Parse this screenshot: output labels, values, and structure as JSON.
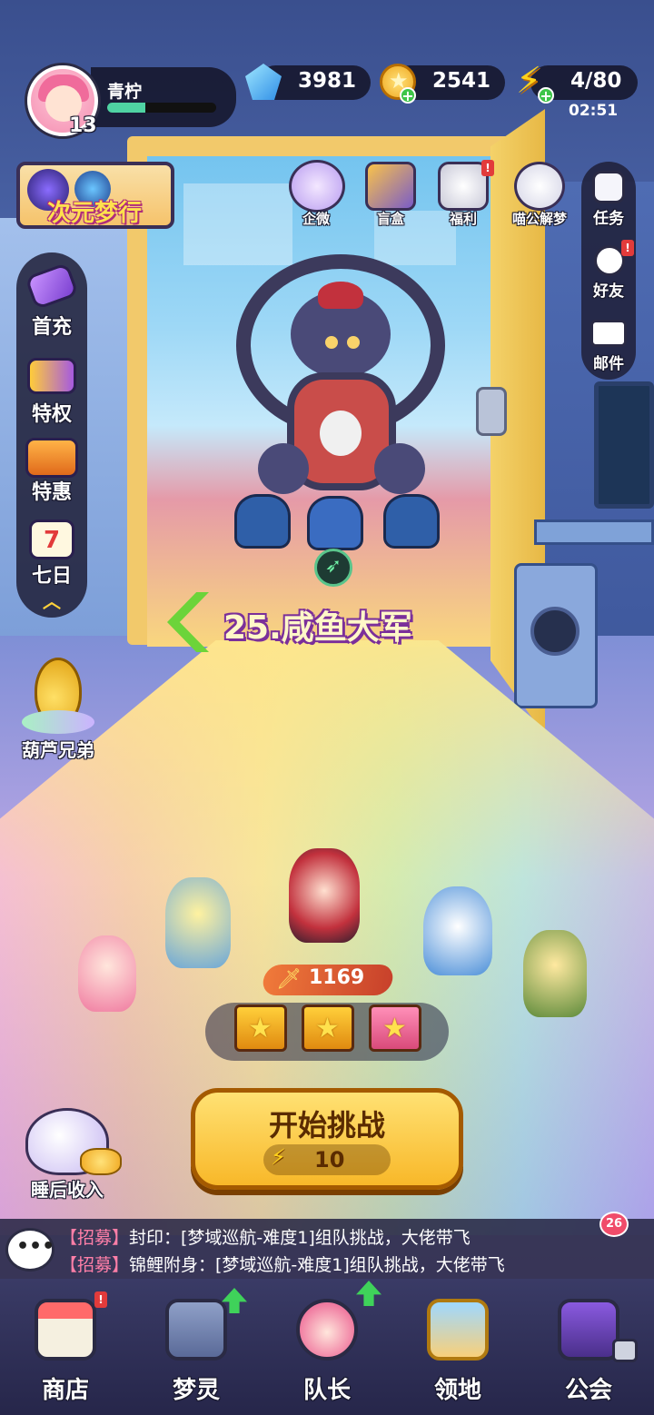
{
  "player": {
    "name": "青柠",
    "level": "13",
    "xp_progress": 0.35
  },
  "resources": {
    "gems": "3981",
    "coins": "2541",
    "energy": "4/80",
    "energy_timer": "02:51"
  },
  "event_banner": {
    "label": "次元梦行"
  },
  "top_icons": [
    {
      "label": "企微",
      "icon": "gift-icon",
      "badge": false
    },
    {
      "label": "盲盒",
      "icon": "blind-box-icon",
      "badge": false
    },
    {
      "label": "福利",
      "icon": "welfare-gift-icon",
      "badge": true
    },
    {
      "label": "喵公解梦",
      "icon": "cat-icon",
      "badge": false
    }
  ],
  "right_menu": [
    {
      "label": "任务",
      "icon": "task-icon",
      "badge": false
    },
    {
      "label": "好友",
      "icon": "friends-icon",
      "badge": true
    },
    {
      "label": "邮件",
      "icon": "mail-icon",
      "badge": false
    }
  ],
  "left_menu": [
    {
      "label": "首充",
      "icon": "hammer-icon"
    },
    {
      "label": "特权",
      "icon": "card-icon"
    },
    {
      "label": "特惠",
      "icon": "sale-box-icon"
    },
    {
      "label": "七日",
      "icon": "calendar-icon",
      "calendar_num": "7"
    }
  ],
  "gourd_event": {
    "label": "葫芦兄弟"
  },
  "stage": {
    "title": "25.咸鱼大军"
  },
  "team": {
    "power": "1169",
    "chests": 3
  },
  "start_button": {
    "label": "开始挑战",
    "cost": "10"
  },
  "sleep_reward": {
    "label": "睡后收入"
  },
  "chat": {
    "unread": "26",
    "lines": [
      {
        "tag": "【招募】",
        "text": "封印：[梦域巡航-难度1]组队挑战，大佬带飞"
      },
      {
        "tag": "【招募】",
        "text": "锦鲤附身：[梦域巡航-难度1]组队挑战，大佬带飞"
      }
    ]
  },
  "bottom_nav": [
    {
      "label": "商店",
      "icon": "shop-icon",
      "badge": true,
      "upgrade": false,
      "locked": false
    },
    {
      "label": "梦灵",
      "icon": "robot-icon",
      "badge": false,
      "upgrade": true,
      "locked": false
    },
    {
      "label": "队长",
      "icon": "captain-icon",
      "badge": false,
      "upgrade": true,
      "locked": false
    },
    {
      "label": "领地",
      "icon": "territory-door-icon",
      "badge": false,
      "upgrade": false,
      "locked": false
    },
    {
      "label": "公会",
      "icon": "guild-icon",
      "badge": false,
      "upgrade": false,
      "locked": true
    }
  ],
  "colors": {
    "accent_green": "#6cd43a",
    "start_yellow": "#f8b829",
    "badge_red": "#e23b3b",
    "chat_tag_pink": "#ff7fa8"
  }
}
